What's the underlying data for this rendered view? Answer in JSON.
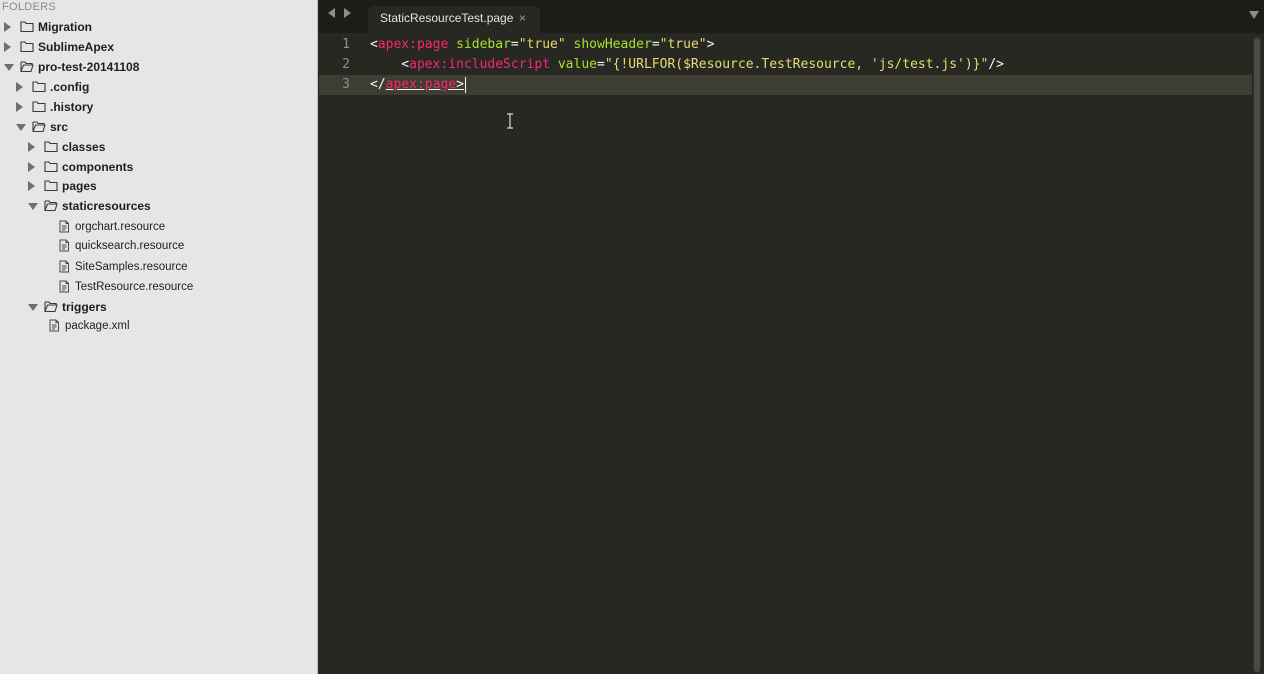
{
  "sidebar": {
    "header": "FOLDERS",
    "tree": [
      {
        "label": "Migration",
        "kind": "folder",
        "expanded": false,
        "depth": 0
      },
      {
        "label": "SublimeApex",
        "kind": "folder",
        "expanded": false,
        "depth": 0
      },
      {
        "label": "pro-test-20141108",
        "kind": "folder",
        "expanded": true,
        "depth": 0
      },
      {
        "label": ".config",
        "kind": "folder",
        "expanded": false,
        "depth": 1
      },
      {
        "label": ".history",
        "kind": "folder",
        "expanded": false,
        "depth": 1
      },
      {
        "label": "src",
        "kind": "folder",
        "expanded": true,
        "depth": 1
      },
      {
        "label": "classes",
        "kind": "folder",
        "expanded": false,
        "depth": 2
      },
      {
        "label": "components",
        "kind": "folder",
        "expanded": false,
        "depth": 2
      },
      {
        "label": "pages",
        "kind": "folder",
        "expanded": false,
        "depth": 2
      },
      {
        "label": "staticresources",
        "kind": "folder",
        "expanded": true,
        "depth": 2
      },
      {
        "label": "orgchart.resource",
        "kind": "file",
        "depth": 3
      },
      {
        "label": "quicksearch.resource",
        "kind": "file",
        "depth": 3
      },
      {
        "label": "SiteSamples.resource",
        "kind": "file",
        "depth": 3
      },
      {
        "label": "TestResource.resource",
        "kind": "file",
        "depth": 3
      },
      {
        "label": "triggers",
        "kind": "folder",
        "expanded": true,
        "depth": 2
      },
      {
        "label": "package.xml",
        "kind": "file",
        "depth": 2
      }
    ]
  },
  "editor": {
    "tab": {
      "title": "StaticResourceTest.page",
      "close_glyph": "×"
    },
    "active_line": 3,
    "lines": [
      {
        "number": "1",
        "tokens": [
          {
            "t": "<",
            "c": "punct"
          },
          {
            "t": "apex:page",
            "c": "tag"
          },
          {
            "t": " ",
            "c": "punct"
          },
          {
            "t": "sidebar",
            "c": "attr"
          },
          {
            "t": "=",
            "c": "punct"
          },
          {
            "t": "\"true\"",
            "c": "str"
          },
          {
            "t": " ",
            "c": "punct"
          },
          {
            "t": "showHeader",
            "c": "attr"
          },
          {
            "t": "=",
            "c": "punct"
          },
          {
            "t": "\"true\"",
            "c": "str"
          },
          {
            "t": ">",
            "c": "punct"
          }
        ]
      },
      {
        "number": "2",
        "tokens": [
          {
            "t": "    <",
            "c": "punct"
          },
          {
            "t": "apex:includeScript",
            "c": "tag"
          },
          {
            "t": " ",
            "c": "punct"
          },
          {
            "t": "value",
            "c": "attr"
          },
          {
            "t": "=",
            "c": "punct"
          },
          {
            "t": "\"{!URLFOR($Resource.TestResource, 'js/test.js')}\"",
            "c": "str"
          },
          {
            "t": "/>",
            "c": "punct"
          }
        ]
      },
      {
        "number": "3",
        "tokens": [
          {
            "t": "</",
            "c": "punct"
          },
          {
            "t": "apex:page",
            "c": "tag underline"
          },
          {
            "t": ">",
            "c": "punct underline"
          }
        ]
      }
    ]
  },
  "icons": {
    "nav_back": "left-triangle",
    "nav_forward": "right-triangle",
    "folder": "folder-outline",
    "file": "document-outline",
    "tab_menu": "down-triangle",
    "cursor": "i-beam"
  },
  "colors": {
    "sidebar_bg": "#e6e6e6",
    "editor_bg": "#272822",
    "tag": "#f92672",
    "attribute": "#a6e22e",
    "string": "#e6db74",
    "text": "#f8f8f2",
    "line_highlight": "#3e3d32"
  }
}
